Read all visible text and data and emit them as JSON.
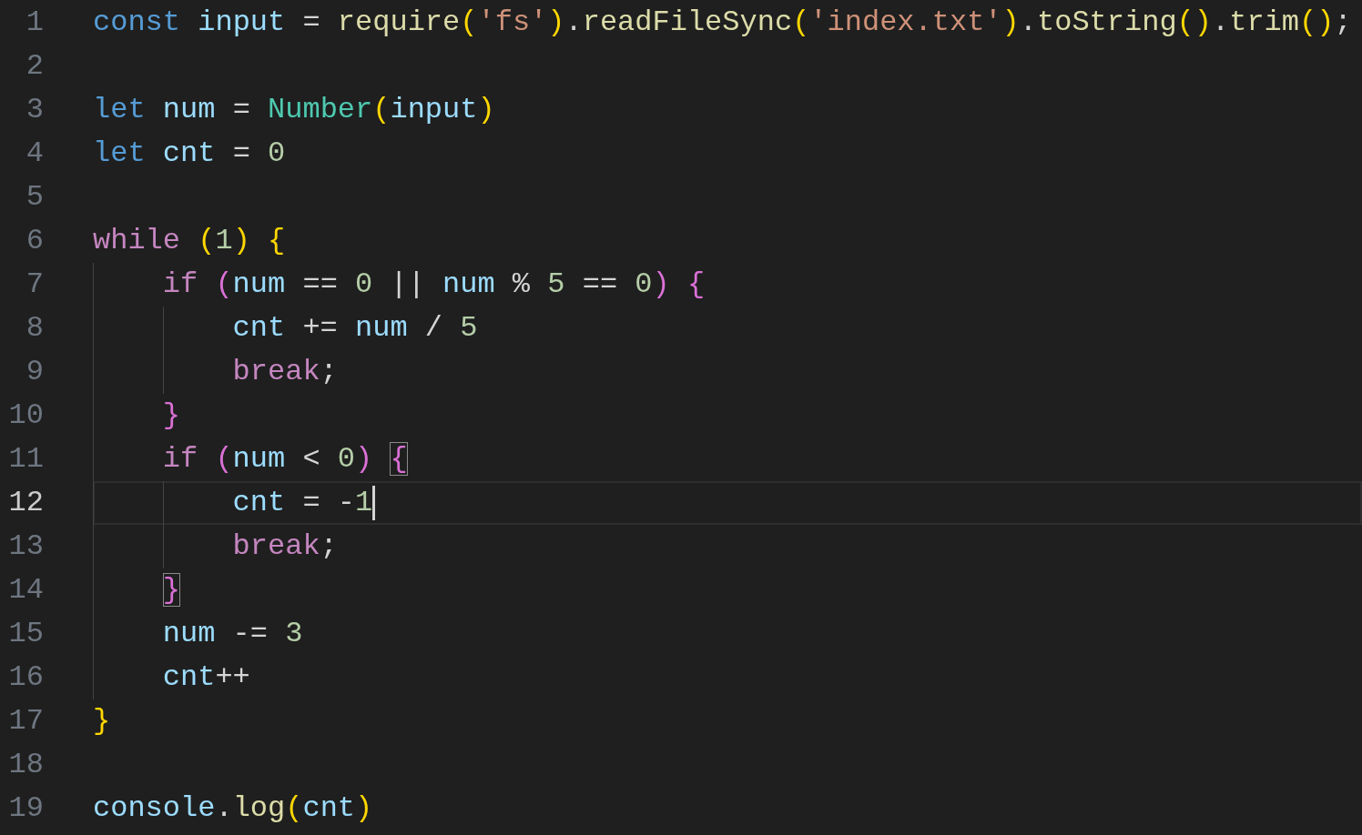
{
  "editor": {
    "lines": [
      {
        "number": "1",
        "kind": "top",
        "selected": false,
        "caret": false,
        "tokens": [
          {
            "text": "const ",
            "kind": "keyword"
          },
          {
            "text": "input",
            "kind": "variable"
          },
          {
            "text": " = ",
            "kind": "operator"
          },
          {
            "text": "require",
            "kind": "function"
          },
          {
            "text": "(",
            "kind": "bracket1",
            "matched": false
          },
          {
            "text": "'fs'",
            "kind": "string"
          },
          {
            "text": ")",
            "kind": "bracket1",
            "matched": false
          },
          {
            "text": ".",
            "kind": "operator"
          },
          {
            "text": "readFileSync",
            "kind": "function"
          },
          {
            "text": "(",
            "kind": "bracket1",
            "matched": false
          },
          {
            "text": "'index.txt'",
            "kind": "string"
          },
          {
            "text": ")",
            "kind": "bracket1",
            "matched": false
          },
          {
            "text": ".",
            "kind": "operator"
          },
          {
            "text": "toString",
            "kind": "function"
          },
          {
            "text": "()",
            "kind": "bracket1",
            "matched": false
          },
          {
            "text": ".",
            "kind": "operator"
          },
          {
            "text": "trim",
            "kind": "function"
          },
          {
            "text": "()",
            "kind": "bracket1",
            "matched": false
          },
          {
            "text": ";",
            "kind": "operator"
          }
        ]
      },
      {
        "number": "2",
        "kind": "top",
        "selected": false,
        "caret": false
      },
      {
        "number": "3",
        "kind": "top",
        "selected": false,
        "caret": false,
        "tokens": [
          {
            "text": "let ",
            "kind": "keyword"
          },
          {
            "text": "num",
            "kind": "variable"
          },
          {
            "text": " = ",
            "kind": "operator"
          },
          {
            "text": "Number",
            "kind": "class"
          },
          {
            "text": "(",
            "kind": "bracket1",
            "matched": false
          },
          {
            "text": "input",
            "kind": "variable"
          },
          {
            "text": ")",
            "kind": "bracket1",
            "matched": false
          }
        ]
      },
      {
        "number": "4",
        "kind": "top",
        "selected": false,
        "caret": false,
        "tokens": [
          {
            "text": "let ",
            "kind": "keyword"
          },
          {
            "text": "cnt",
            "kind": "variable"
          },
          {
            "text": " = ",
            "kind": "operator"
          },
          {
            "text": "0",
            "kind": "number"
          }
        ]
      },
      {
        "number": "5",
        "kind": "top",
        "selected": false,
        "caret": false
      },
      {
        "number": "6",
        "kind": "top",
        "selected": false,
        "caret": false,
        "tokens": [
          {
            "text": "while ",
            "kind": "control"
          },
          {
            "text": "(",
            "kind": "bracket1",
            "matched": false
          },
          {
            "text": "1",
            "kind": "number"
          },
          {
            "text": ") ",
            "kind": "bracket1",
            "matched": false
          },
          {
            "text": "{",
            "kind": "bracket1",
            "matched": false
          }
        ]
      },
      {
        "number": "7",
        "kind": "inner",
        "selected": false,
        "caret": false,
        "tokens": [
          {
            "text": "if ",
            "kind": "control"
          },
          {
            "text": "(",
            "kind": "bracket2",
            "matched": false
          },
          {
            "text": "num",
            "kind": "variable"
          },
          {
            "text": " == ",
            "kind": "operator"
          },
          {
            "text": "0",
            "kind": "number"
          },
          {
            "text": " || ",
            "kind": "operator"
          },
          {
            "text": "num",
            "kind": "variable"
          },
          {
            "text": " % ",
            "kind": "operator"
          },
          {
            "text": "5",
            "kind": "number"
          },
          {
            "text": " == ",
            "kind": "operator"
          },
          {
            "text": "0",
            "kind": "number"
          },
          {
            "text": ") ",
            "kind": "bracket2",
            "matched": false
          },
          {
            "text": "{",
            "kind": "bracket2",
            "matched": false
          }
        ]
      },
      {
        "number": "8",
        "kind": "innermost",
        "selected": false,
        "caret": false,
        "tokens": [
          {
            "text": "cnt",
            "kind": "variable"
          },
          {
            "text": " += ",
            "kind": "operator"
          },
          {
            "text": "num",
            "kind": "variable"
          },
          {
            "text": " / ",
            "kind": "operator"
          },
          {
            "text": "5",
            "kind": "number"
          }
        ]
      },
      {
        "number": "9",
        "kind": "innermost",
        "selected": false,
        "caret": false,
        "tokens": [
          {
            "text": "break",
            "kind": "control"
          },
          {
            "text": ";",
            "kind": "operator"
          }
        ]
      },
      {
        "number": "10",
        "kind": "inner",
        "selected": false,
        "caret": false,
        "tokens": [
          {
            "text": "}",
            "kind": "bracket2",
            "matched": false
          }
        ]
      },
      {
        "number": "11",
        "kind": "inner",
        "selected": false,
        "caret": false,
        "tokens": [
          {
            "text": "if ",
            "kind": "control"
          },
          {
            "text": "(",
            "kind": "bracket2",
            "matched": false
          },
          {
            "text": "num",
            "kind": "variable"
          },
          {
            "text": " < ",
            "kind": "operator"
          },
          {
            "text": "0",
            "kind": "number"
          },
          {
            "text": ") ",
            "kind": "bracket2",
            "matched": false
          },
          {
            "text": "{",
            "kind": "bracket2",
            "matched": true
          }
        ]
      },
      {
        "number": "12",
        "kind": "innermost",
        "selected": true,
        "caret": true,
        "tokens": [
          {
            "text": "cnt",
            "kind": "variable"
          },
          {
            "text": " = ",
            "kind": "operator"
          },
          {
            "text": "-",
            "kind": "operator"
          },
          {
            "text": "1",
            "kind": "number"
          }
        ]
      },
      {
        "number": "13",
        "kind": "innermost",
        "selected": false,
        "caret": false,
        "tokens": [
          {
            "text": "break",
            "kind": "control"
          },
          {
            "text": ";",
            "kind": "operator"
          }
        ]
      },
      {
        "number": "14",
        "kind": "inner",
        "selected": false,
        "caret": false,
        "tokens": [
          {
            "text": "}",
            "kind": "bracket2",
            "matched": true
          }
        ]
      },
      {
        "number": "15",
        "kind": "inner",
        "selected": false,
        "caret": false,
        "tokens": [
          {
            "text": "num",
            "kind": "variable"
          },
          {
            "text": " -= ",
            "kind": "operator"
          },
          {
            "text": "3",
            "kind": "number"
          }
        ]
      },
      {
        "number": "16",
        "kind": "inner",
        "selected": false,
        "caret": false,
        "tokens": [
          {
            "text": "cnt",
            "kind": "variable"
          },
          {
            "text": "++",
            "kind": "operator"
          }
        ]
      },
      {
        "number": "17",
        "kind": "top",
        "selected": false,
        "caret": false,
        "tokens": [
          {
            "text": "}",
            "kind": "bracket1",
            "matched": false
          }
        ]
      },
      {
        "number": "18",
        "kind": "top",
        "selected": false,
        "caret": false
      },
      {
        "number": "19",
        "kind": "top",
        "selected": false,
        "caret": false,
        "tokens": [
          {
            "text": "console",
            "kind": "variable"
          },
          {
            "text": ".",
            "kind": "operator"
          },
          {
            "text": "log",
            "kind": "function"
          },
          {
            "text": "(",
            "kind": "bracket1",
            "matched": false
          },
          {
            "text": "cnt",
            "kind": "variable"
          },
          {
            "text": ")",
            "kind": "bracket1",
            "matched": false
          }
        ]
      }
    ]
  }
}
